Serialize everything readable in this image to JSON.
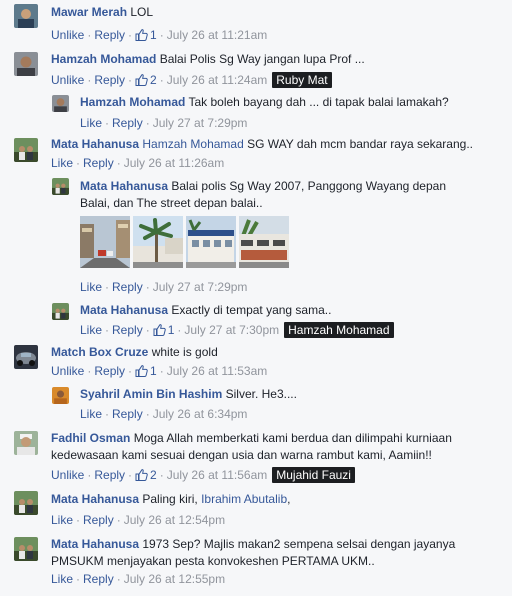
{
  "actions": {
    "like": "Like",
    "unlike": "Unlike",
    "reply": "Reply",
    "sep": "·"
  },
  "comments": [
    {
      "author": "Mawar Merah",
      "text": "LOL",
      "state": "Unlike",
      "likes": "1",
      "time": "July 26 at 11:21am"
    },
    {
      "author": "Hamzah Mohamad",
      "text": "Balai Polis Sg Way jangan lupa Prof ...",
      "state": "Unlike",
      "likes": "2",
      "time": "July 26 at 11:24am",
      "tag": "Ruby Mat"
    },
    {
      "author": "Hamzah Mohamad",
      "text": "Tak boleh bayang dah ... di tapak balai lamakah?",
      "state": "Like",
      "time": "July 27 at 7:29pm"
    },
    {
      "author": "Mata Hahanusa",
      "mention": "Hamzah Mohamad",
      "text": "SG WAY dah mcm bandar raya sekarang..",
      "state": "Like",
      "time": "July 26 at 11:26am"
    },
    {
      "author": "Mata Hahanusa",
      "text": "Balai polis Sg Way 2007, Panggong Wayang depan Balai, dan The street depan balai..",
      "state": "Like",
      "time": "July 27 at 7:29pm",
      "photos": [
        "street-photo",
        "palm-photo",
        "building-photo",
        "shop-photo"
      ]
    },
    {
      "author": "Mata Hahanusa",
      "text": "Exactly di tempat yang sama..",
      "state": "Like",
      "likes": "1",
      "time": "July 27 at 7:30pm",
      "tag": "Hamzah Mohamad"
    },
    {
      "author": "Match Box Cruze",
      "text": "white is gold",
      "state": "Unlike",
      "likes": "1",
      "time": "July 26 at 11:53am"
    },
    {
      "author": "Syahril Amin Bin Hashim",
      "text": "Silver. He3....",
      "state": "Like",
      "time": "July 26 at 6:34pm"
    },
    {
      "author": "Fadhil Osman",
      "text": "Moga Allah memberkati kami berdua dan dilimpahi kurniaan kedewasaan kami sesuai dengan usia dan warna rambut kami, Aamiin!!",
      "state": "Unlike",
      "likes": "2",
      "time": "July 26 at 11:56am",
      "tag": "Mujahid Fauzi"
    },
    {
      "author": "Mata Hahanusa",
      "text": "Paling kiri, ",
      "mention_after": "Ibrahim Abutalib",
      "text_after": ",",
      "state": "Like",
      "time": "July 26 at 12:54pm"
    },
    {
      "author": "Mata Hahanusa",
      "text": "1973 Sep? Majlis makan2 sempena selsai dengan jayanya PMSUKM menjayakan pesta konvokeshen PERTAMA UKM..",
      "state": "Like",
      "time": "July 26 at 12:55pm"
    }
  ],
  "colors": {
    "link": "#365899",
    "meta": "#90949c",
    "text": "#1d2129",
    "background": "#f6f7f9",
    "tag_bg": "#1c1e21"
  }
}
